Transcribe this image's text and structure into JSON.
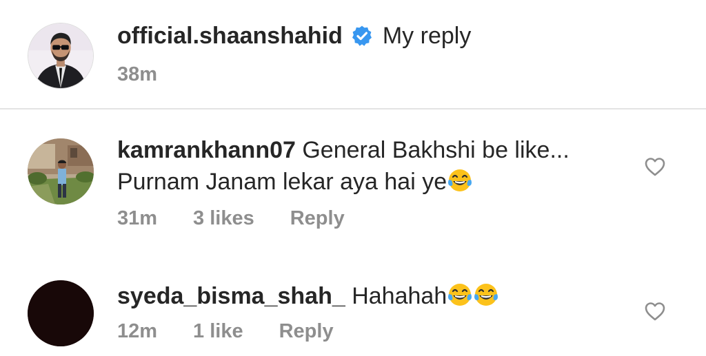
{
  "caption": {
    "username": "official.shaanshahid",
    "text": "My reply",
    "time": "38m",
    "verified_color": "#3897f0",
    "verified_icon": "verified-badge-icon"
  },
  "comments": [
    {
      "username": "kamrankhann07",
      "text_line1": "General Bakhshi be like...",
      "text_line2": "Purnam Janam lekar aya hai ye",
      "emoji": "tears-of-joy-emoji",
      "time": "31m",
      "likes": "3 likes",
      "reply_label": "Reply"
    },
    {
      "username": "syeda_bisma_shah_",
      "text": "Hahahah",
      "emoji": "tears-of-joy-emoji",
      "time": "12m",
      "likes": "1 like",
      "reply_label": "Reply"
    }
  ],
  "colors": {
    "text": "#262626",
    "meta": "#8e8e8e",
    "divider": "#e3e3e3",
    "verified": "#3897f0"
  }
}
